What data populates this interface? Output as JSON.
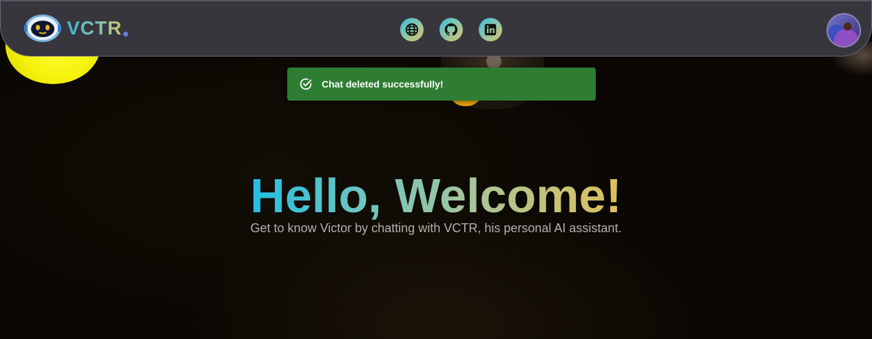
{
  "header": {
    "brand": "VCTR",
    "accent_color": "#6d7bf0",
    "links": [
      {
        "name": "globe-icon",
        "label": "Website"
      },
      {
        "name": "github-icon",
        "label": "GitHub"
      },
      {
        "name": "linkedin-icon",
        "label": "LinkedIn"
      }
    ],
    "avatar_icon": "user-avatar"
  },
  "toast": {
    "message": "Chat deleted successfully!",
    "icon": "check-circle-icon",
    "color": "#2e7d32"
  },
  "hero": {
    "title": "Hello, Welcome!",
    "subtitle": "Get to know Victor by chatting with VCTR, his personal AI assistant."
  }
}
